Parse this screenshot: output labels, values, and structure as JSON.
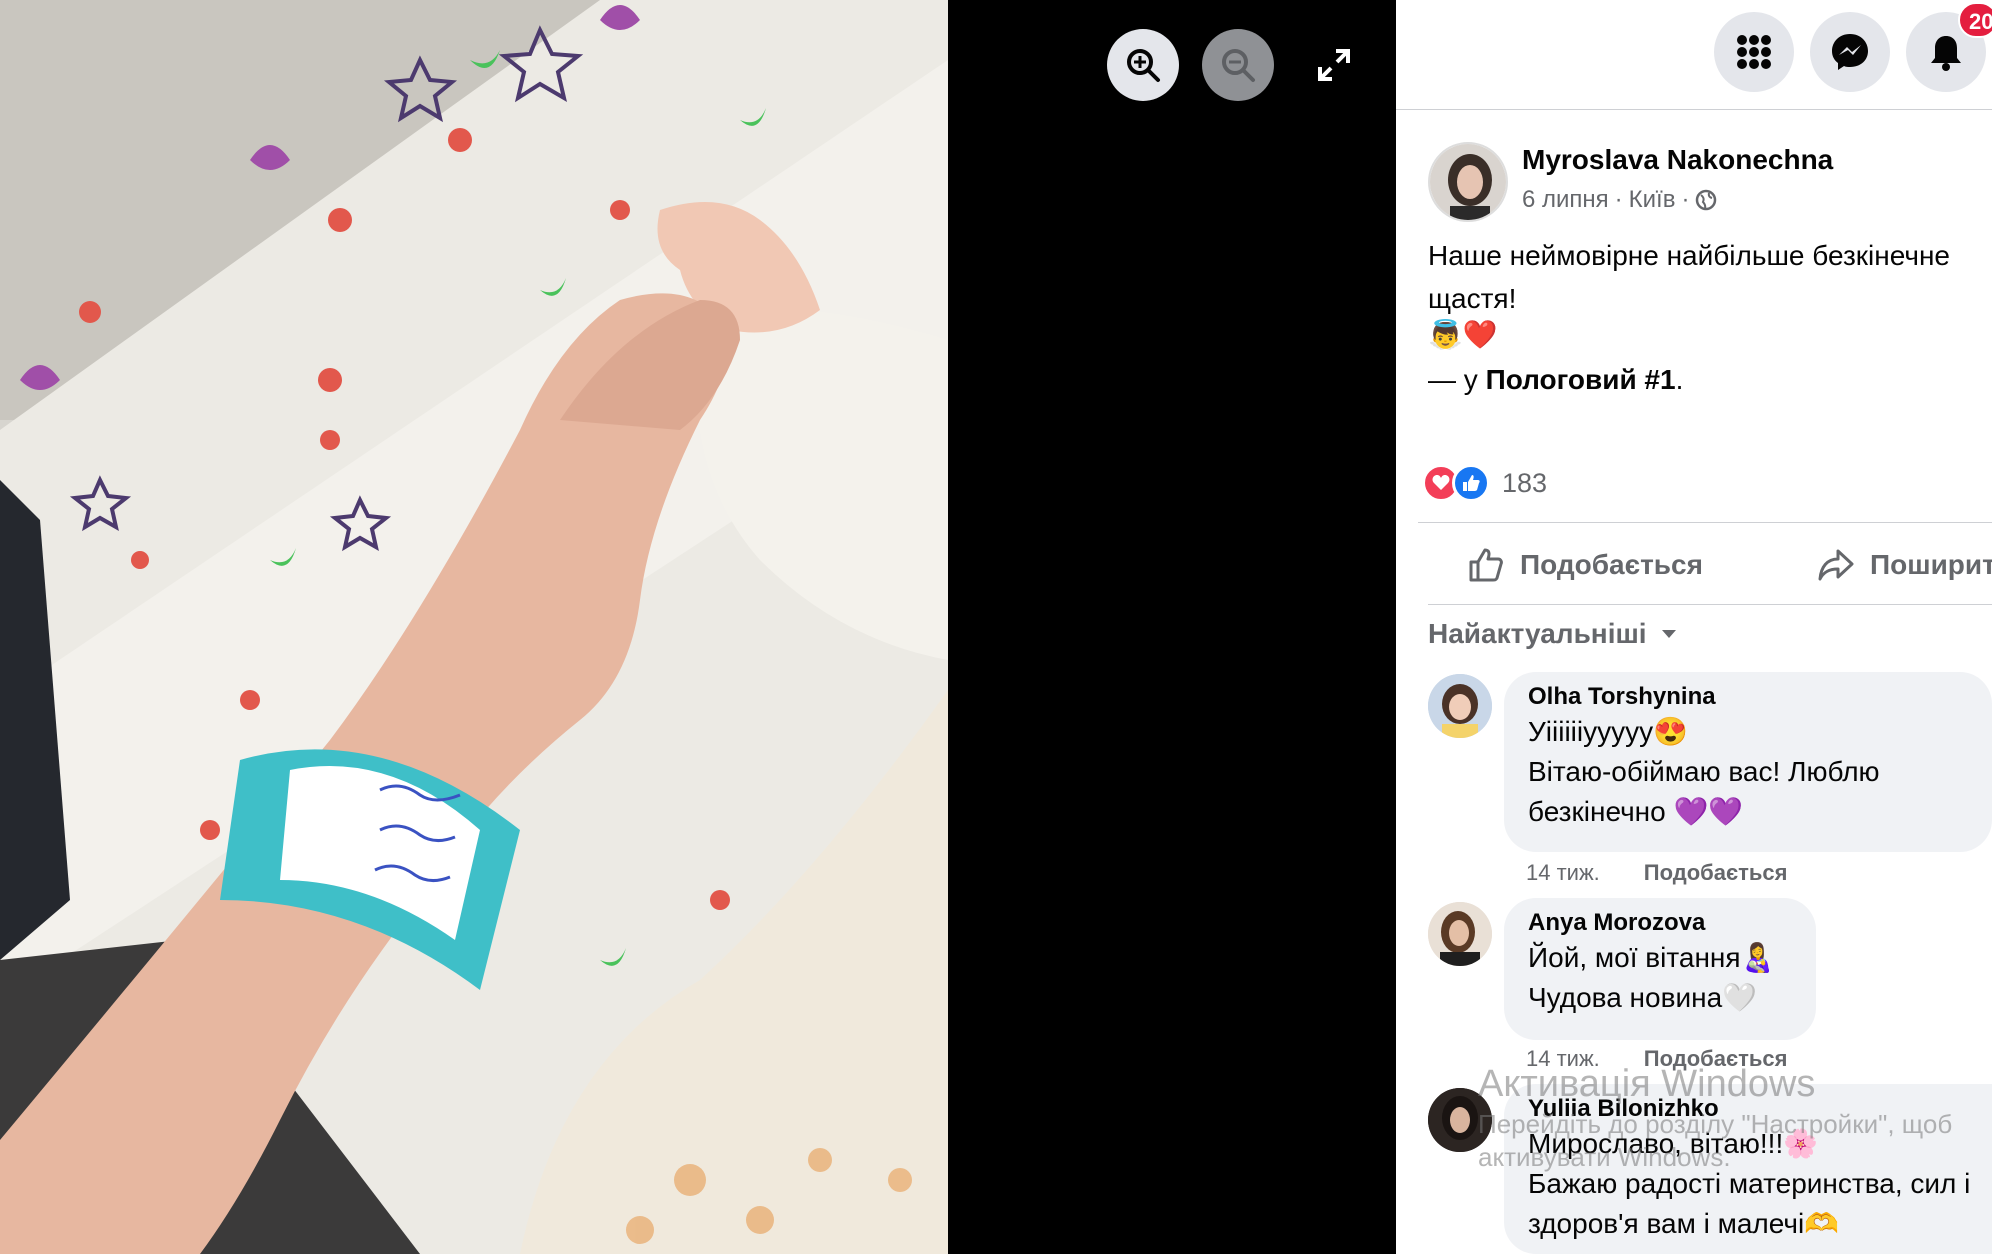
{
  "viewer": {
    "zoom_in_icon": "zoom-in-icon",
    "zoom_out_icon": "zoom-out-icon",
    "fullscreen_icon": "fullscreen-icon"
  },
  "topbar": {
    "notification_count": "20"
  },
  "post": {
    "author": "Myroslava Nakonechna",
    "date": "6 липня",
    "separator": "·",
    "city": "Київ",
    "text": "Наше неймовірне найбільше безкінечне щастя!",
    "emoji": "👼❤️",
    "location_prefix": "— у ",
    "location_name": "Пологовий #1",
    "location_suffix": ".",
    "reaction_count": "183",
    "like_label": "Подобається",
    "share_label": "Поширити"
  },
  "comments": {
    "sort_label": "Найактуальніші",
    "items": [
      {
        "name": "Olha Torshynina",
        "lines": [
          "Уііііііууууу😍",
          "Вітаю-обіймаю вас! Люблю",
          "безкінечно 💜💜"
        ],
        "time": "14 тиж.",
        "like": "Подобається"
      },
      {
        "name": "Anya Morozova",
        "lines": [
          "Йой, мої вітання👩‍🍼",
          "Чудова новина🤍"
        ],
        "time": "14 тиж.",
        "like": "Подобається"
      },
      {
        "name": "Yuliia Bilonizhko",
        "lines": [
          "Мирославо, вітаю!!!🌸",
          "Бажаю радості материнства, сил і",
          "здоров'я вам і малечі🫶"
        ]
      }
    ]
  },
  "watermark": {
    "title": "Активація Windows",
    "line1": "Перейдіть до розділу \"Настройки\", щоб",
    "line2": "активувати Windows."
  },
  "colors": {
    "accent": "#1877f2",
    "love": "#f33e58",
    "badge": "#e41e3f",
    "secondary_text": "#65676b"
  }
}
